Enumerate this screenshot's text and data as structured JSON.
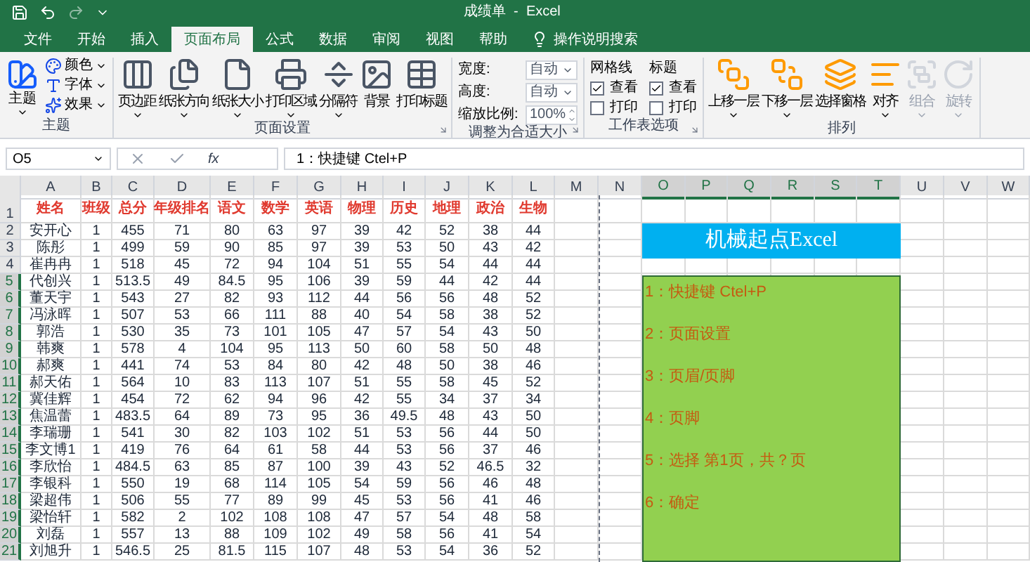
{
  "window": {
    "title": "成绩单  -  Excel"
  },
  "tabs": [
    {
      "label": "文件",
      "selected": false
    },
    {
      "label": "开始",
      "selected": false
    },
    {
      "label": "插入",
      "selected": false
    },
    {
      "label": "页面布局",
      "selected": true
    },
    {
      "label": "公式",
      "selected": false
    },
    {
      "label": "数据",
      "selected": false
    },
    {
      "label": "审阅",
      "selected": false
    },
    {
      "label": "视图",
      "selected": false
    },
    {
      "label": "帮助",
      "selected": false
    }
  ],
  "search": {
    "label": "操作说明搜索"
  },
  "ribbon": {
    "groups": [
      {
        "kind": "themes",
        "label": "主题",
        "launcher": false,
        "main": "主题",
        "items": [
          "颜色",
          "字体",
          "效果"
        ]
      },
      {
        "kind": "buttons",
        "label": "页面设置",
        "launcher": true,
        "buttons": [
          {
            "label": "页边距",
            "dropdown": true,
            "disabled": false
          },
          {
            "label": "纸张方向",
            "dropdown": true,
            "disabled": false
          },
          {
            "label": "纸张大小",
            "dropdown": true,
            "disabled": false
          },
          {
            "label": "打印区域",
            "dropdown": true,
            "disabled": false
          },
          {
            "label": "分隔符",
            "dropdown": true,
            "disabled": false
          },
          {
            "label": "背景",
            "dropdown": false,
            "disabled": false
          },
          {
            "label": "打印标题",
            "dropdown": false,
            "disabled": false
          }
        ]
      },
      {
        "kind": "fit",
        "label": "调整为合适大小",
        "launcher": true,
        "fields": [
          {
            "label": "宽度:",
            "value": "自动",
            "kind": "dropdown"
          },
          {
            "label": "高度:",
            "value": "自动",
            "kind": "dropdown"
          },
          {
            "label": "缩放比例:",
            "value": "100%",
            "kind": "spin"
          }
        ]
      },
      {
        "kind": "options",
        "label": "工作表选项",
        "launcher": true,
        "columns": [
          {
            "title": "网格线",
            "options": [
              {
                "label": "查看",
                "checked": true
              },
              {
                "label": "打印",
                "checked": false
              }
            ]
          },
          {
            "title": "标题",
            "options": [
              {
                "label": "查看",
                "checked": true
              },
              {
                "label": "打印",
                "checked": false
              }
            ]
          }
        ]
      },
      {
        "kind": "buttons",
        "label": "排列",
        "launcher": false,
        "buttons": [
          {
            "label": "上移一层",
            "dropdown": true,
            "disabled": false
          },
          {
            "label": "下移一层",
            "dropdown": true,
            "disabled": false
          },
          {
            "label": "选择窗格",
            "dropdown": false,
            "disabled": false
          },
          {
            "label": "对齐",
            "dropdown": true,
            "disabled": false
          },
          {
            "label": "组合",
            "dropdown": true,
            "disabled": true
          },
          {
            "label": "旋转",
            "dropdown": true,
            "disabled": true
          }
        ]
      }
    ]
  },
  "formula_bar": {
    "name_box": "O5",
    "function_label": "fx",
    "content": "1：快捷键 Ctel+P"
  },
  "sheet": {
    "columns": [
      {
        "label": "A",
        "selected": false
      },
      {
        "label": "B",
        "selected": false
      },
      {
        "label": "C",
        "selected": false
      },
      {
        "label": "D",
        "selected": false
      },
      {
        "label": "E",
        "selected": false
      },
      {
        "label": "F",
        "selected": false
      },
      {
        "label": "G",
        "selected": false
      },
      {
        "label": "H",
        "selected": false
      },
      {
        "label": "I",
        "selected": false
      },
      {
        "label": "J",
        "selected": false
      },
      {
        "label": "K",
        "selected": false
      },
      {
        "label": "L",
        "selected": false
      },
      {
        "label": "M",
        "selected": false
      },
      {
        "label": "N",
        "selected": false
      },
      {
        "label": "O",
        "selected": true
      },
      {
        "label": "P",
        "selected": true
      },
      {
        "label": "Q",
        "selected": true
      },
      {
        "label": "R",
        "selected": true
      },
      {
        "label": "S",
        "selected": true
      },
      {
        "label": "T",
        "selected": true
      },
      {
        "label": "U",
        "selected": false
      },
      {
        "label": "V",
        "selected": false
      },
      {
        "label": "W",
        "selected": false
      }
    ],
    "rows": [
      {
        "label": "1",
        "selected": false,
        "kind": "header",
        "cells": [
          "姓名",
          "班级",
          "总分",
          "年级排名",
          "语文",
          "数学",
          "英语",
          "物理",
          "历史",
          "地理",
          "政治",
          "生物"
        ]
      },
      {
        "label": "2",
        "selected": false,
        "kind": "data",
        "cells": [
          "安开心",
          "1",
          "455",
          "71",
          "80",
          "63",
          "97",
          "39",
          "42",
          "52",
          "38",
          "44"
        ]
      },
      {
        "label": "3",
        "selected": false,
        "kind": "data",
        "cells": [
          "陈彤",
          "1",
          "499",
          "59",
          "90",
          "85",
          "97",
          "39",
          "53",
          "50",
          "43",
          "42"
        ]
      },
      {
        "label": "4",
        "selected": false,
        "kind": "data",
        "cells": [
          "崔冉冉",
          "1",
          "518",
          "45",
          "72",
          "94",
          "104",
          "51",
          "55",
          "54",
          "44",
          "44"
        ]
      },
      {
        "label": "5",
        "selected": true,
        "kind": "data",
        "cells": [
          "代创兴",
          "1",
          "513.5",
          "49",
          "84.5",
          "95",
          "106",
          "39",
          "59",
          "44",
          "42",
          "44"
        ]
      },
      {
        "label": "6",
        "selected": true,
        "kind": "data",
        "cells": [
          "董天宇",
          "1",
          "543",
          "27",
          "82",
          "93",
          "112",
          "44",
          "56",
          "56",
          "48",
          "52"
        ]
      },
      {
        "label": "7",
        "selected": true,
        "kind": "data",
        "cells": [
          "冯泳晖",
          "1",
          "507",
          "53",
          "66",
          "111",
          "88",
          "40",
          "54",
          "58",
          "38",
          "52"
        ]
      },
      {
        "label": "8",
        "selected": true,
        "kind": "data",
        "cells": [
          "郭浩",
          "1",
          "530",
          "35",
          "73",
          "101",
          "105",
          "47",
          "57",
          "54",
          "43",
          "50"
        ]
      },
      {
        "label": "9",
        "selected": true,
        "kind": "data",
        "cells": [
          "韩爽",
          "1",
          "578",
          "4",
          "104",
          "95",
          "113",
          "50",
          "60",
          "58",
          "50",
          "48"
        ]
      },
      {
        "label": "10",
        "selected": true,
        "kind": "data",
        "cells": [
          "郝爽",
          "1",
          "441",
          "74",
          "53",
          "84",
          "80",
          "42",
          "48",
          "50",
          "38",
          "46"
        ]
      },
      {
        "label": "11",
        "selected": true,
        "kind": "data",
        "cells": [
          "郝天佑",
          "1",
          "564",
          "10",
          "83",
          "113",
          "107",
          "51",
          "55",
          "58",
          "45",
          "52"
        ]
      },
      {
        "label": "12",
        "selected": true,
        "kind": "data",
        "cells": [
          "冀佳辉",
          "1",
          "454",
          "72",
          "62",
          "94",
          "96",
          "42",
          "55",
          "34",
          "37",
          "34"
        ]
      },
      {
        "label": "13",
        "selected": true,
        "kind": "data",
        "cells": [
          "焦温蕾",
          "1",
          "483.5",
          "64",
          "89",
          "73",
          "95",
          "36",
          "49.5",
          "48",
          "43",
          "50"
        ]
      },
      {
        "label": "14",
        "selected": true,
        "kind": "data",
        "cells": [
          "李瑞珊",
          "1",
          "541",
          "30",
          "82",
          "103",
          "102",
          "51",
          "53",
          "56",
          "44",
          "50"
        ]
      },
      {
        "label": "15",
        "selected": true,
        "kind": "data",
        "cells": [
          "李文博1",
          "1",
          "419",
          "76",
          "64",
          "61",
          "58",
          "44",
          "53",
          "56",
          "37",
          "46"
        ]
      },
      {
        "label": "16",
        "selected": true,
        "kind": "data",
        "cells": [
          "李欣怡",
          "1",
          "484.5",
          "63",
          "85",
          "87",
          "100",
          "39",
          "43",
          "52",
          "46.5",
          "32"
        ]
      },
      {
        "label": "17",
        "selected": true,
        "kind": "data",
        "cells": [
          "李银科",
          "1",
          "550",
          "19",
          "68",
          "114",
          "105",
          "54",
          "59",
          "56",
          "46",
          "48"
        ]
      },
      {
        "label": "18",
        "selected": true,
        "kind": "data",
        "cells": [
          "梁超伟",
          "1",
          "506",
          "55",
          "77",
          "89",
          "99",
          "45",
          "53",
          "56",
          "41",
          "46"
        ]
      },
      {
        "label": "19",
        "selected": true,
        "kind": "data",
        "cells": [
          "梁怡轩",
          "1",
          "582",
          "2",
          "102",
          "108",
          "108",
          "47",
          "57",
          "54",
          "48",
          "58"
        ]
      },
      {
        "label": "20",
        "selected": true,
        "kind": "data",
        "cells": [
          "刘磊",
          "1",
          "557",
          "13",
          "88",
          "109",
          "102",
          "49",
          "58",
          "56",
          "41",
          "54"
        ]
      },
      {
        "label": "21",
        "selected": true,
        "kind": "data",
        "cells": [
          "刘旭升",
          "1",
          "546.5",
          "25",
          "81.5",
          "115",
          "107",
          "48",
          "53",
          "54",
          "36",
          "52"
        ]
      }
    ]
  },
  "title_box": {
    "text": "机械起点Excel"
  },
  "note_box": {
    "lines": [
      "1：快捷键 Ctel+P",
      "2：页面设置",
      "3：页眉/页脚",
      "4：页脚",
      "5：选择 第1页，共？页",
      "6：确定"
    ]
  }
}
